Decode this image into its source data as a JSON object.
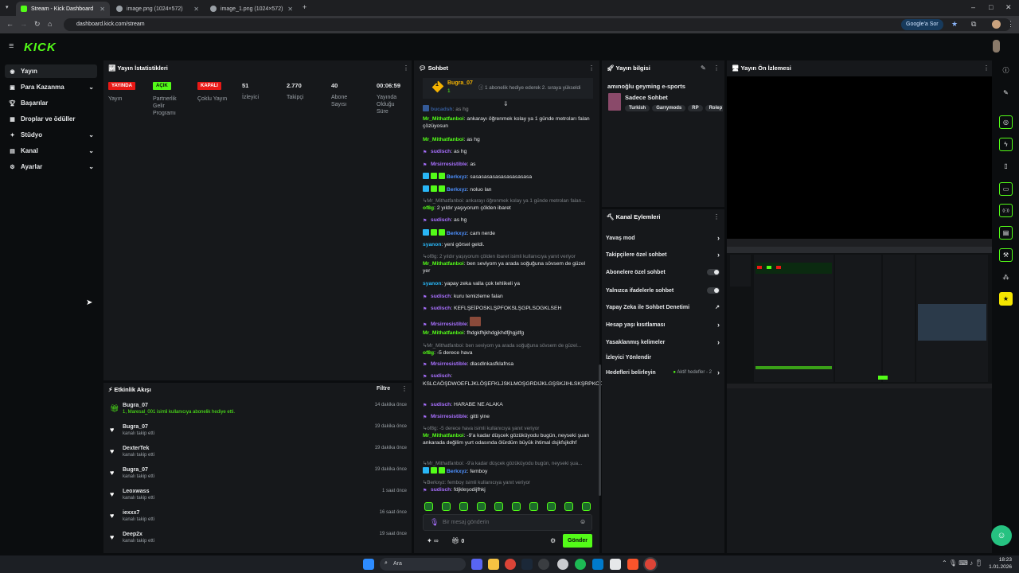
{
  "browser": {
    "tabs": [
      {
        "title": "Stream - Kick Dashboard",
        "active": true
      },
      {
        "title": "image.png (1024×572)",
        "active": false
      },
      {
        "title": "image_1.png (1024×572)",
        "active": false
      }
    ],
    "new_tab": "+",
    "url": "dashboard.kick.com/stream",
    "google_sor": "Google'a Sor"
  },
  "brand": {
    "logo": "KICK",
    "accent": "#53fc18"
  },
  "sidebar": {
    "items": [
      {
        "label": "Yayın",
        "icon": "broadcast-icon"
      },
      {
        "label": "Para Kazanma",
        "icon": "money-icon",
        "chevron": "⌄"
      },
      {
        "label": "Başarılar",
        "icon": "trophy-icon"
      },
      {
        "label": "Droplar ve ödüller",
        "icon": "gift-icon"
      },
      {
        "label": "Stüdyo",
        "icon": "studio-icon",
        "chevron": "⌄"
      },
      {
        "label": "Kanal",
        "icon": "channel-icon",
        "chevron": "⌄"
      },
      {
        "label": "Ayarlar",
        "icon": "gear-icon",
        "chevron": "⌄"
      }
    ]
  },
  "stats": {
    "title": "Yayın İstatistikleri",
    "items": [
      {
        "badge": "YAYINDA",
        "badge_color": "#e91916",
        "label": "Yayın"
      },
      {
        "badge": "AÇIK",
        "badge_color": "#53fc18",
        "label": "Partnerlik Gelir Programı"
      },
      {
        "badge": "KAPALI",
        "badge_color": "#e91916",
        "label": "Çoklu Yayın"
      },
      {
        "value": "51",
        "label": "İzleyici"
      },
      {
        "value": "2.770",
        "label": "Takipçi"
      },
      {
        "value": "40",
        "label": "Abone Sayısı"
      },
      {
        "value": "00:06:59",
        "label": "Yayında Olduğu Süre"
      }
    ]
  },
  "chat": {
    "title": "Sohbet",
    "pinned_user": "Bugra_07",
    "pinned_count": "1",
    "pinned_text": "1 abonelik hediye ederek 2. sıraya yükseldi",
    "partial_user": "bucadsh",
    "partial_msg": "as hg",
    "messages": [
      {
        "user": "Mr_Mithatfanboi",
        "color": "g",
        "text": "ankarayı öğrenmek kolay ya 1 günde metroları falan çözüyosun"
      },
      {
        "user": "Mr_Mithatfanboi",
        "color": "g",
        "text": "as hg"
      },
      {
        "user": "sudisch",
        "color": "p",
        "text": "as hg",
        "badges": 1
      },
      {
        "user": "Mrsirresistible",
        "color": "p",
        "text": "as",
        "badges": 1
      },
      {
        "user": "Berkxyz",
        "color": "b",
        "text": "sasasasasasasasasasasa",
        "badges": 3
      },
      {
        "user": "Berkxyz",
        "color": "b",
        "text": "noluo lan",
        "badges": 3
      },
      {
        "reply": "Mr_Mithatfanboi: ankarayı öğrenmek kolay ya 1 günde metroları falan...",
        "user": "of8g",
        "color": "g",
        "text": "2 yıldır yaşıyorum çölden ibaret"
      },
      {
        "user": "sudisch",
        "color": "p",
        "text": "as hg",
        "badges": 1
      },
      {
        "user": "Berkxyz",
        "color": "b",
        "text": "cam nerde",
        "badges": 3
      },
      {
        "user": "syanon",
        "color": "c",
        "text": "yeni görsel geldi."
      },
      {
        "reply": "of8g: 2 yıldır yaşıyorum çölden ibaret isimli kullanıcıya yanıt veriyor",
        "user": "Mr_Mithatfanboi",
        "color": "g",
        "text": "ben seviyom ya arada soğuğuna sövsem de güzel yer"
      },
      {
        "user": "syanon",
        "color": "c",
        "text": "yapay zeka valla çok tehlikeli ya"
      },
      {
        "user": "sudisch",
        "color": "p",
        "text": "kuru temizleme falan",
        "badges": 1
      },
      {
        "user": "sudisch",
        "color": "p",
        "text": "KEFLŞEİPOSKLŞPFOKSLŞGPLSOGKLSEH",
        "badges": 1
      },
      {
        "user": "Mrsirresistible",
        "color": "p",
        "text": "",
        "badges": 1,
        "image": true
      },
      {
        "user": "Mr_Mithatfanboi",
        "color": "g",
        "text": "fhdgkfhjkhdgjkhdfjhgjdfg"
      },
      {
        "reply": "Mr_Mithatfanboi: ben seviyom ya arada soğuğuna sövsem de güzel...",
        "user": "of8g",
        "color": "g",
        "text": "-5 derece hava"
      },
      {
        "user": "Mrsirresistible",
        "color": "p",
        "text": "dlasdlnkasfklafnsa",
        "badges": 1
      },
      {
        "user": "sudisch",
        "color": "p",
        "text": "KSLCAÖŞDWOEFLJKLÖŞEFKLJSKLMOŞGRDIJKLGŞSKJIHLSKŞRPKOGIJSLKEŞG",
        "badges": 1,
        "newline": true
      },
      {
        "user": "sudisch",
        "color": "p",
        "text": "HARABE NE ALAKA",
        "badges": 1
      },
      {
        "user": "Mrsirresistible",
        "color": "p",
        "text": "gitti yine",
        "badges": 1
      },
      {
        "reply": "of8g: -5 derece hava isimli kullanıcıya yanıt veriyor",
        "user": "Mr_Mithatfanboi",
        "color": "g",
        "text": "-9'a kadar düşcek gözüküyodu bugün, neyseki şuan ankarada değilim yurt odasında ölürdüm büyük ihtimal dsjkfsjkdhf"
      },
      {
        "reply": "Mr_Mithatfanboi: -9'a kadar düşcek gözüküyodu bugün, neyseki şua...",
        "user": "Berkxyz",
        "color": "b",
        "text": "femboy",
        "badges": 3
      },
      {
        "reply": "Berkxyz: femboy isimli kullanıcıya yanıt veriyor",
        "user": "sudisch",
        "color": "p",
        "text": "fdjkleşodijfhkj",
        "badges": 1
      }
    ],
    "input_placeholder": "Bir mesaj gönderin",
    "infinity": "∞",
    "gift_count": "0",
    "send_label": "Gönder"
  },
  "stream_info": {
    "title": "Yayın bilgisi",
    "stream_title": "amınoğlu geyming e-sports",
    "category": "Sadece Sohbet",
    "tags": [
      "Turkish",
      "Garrymods",
      "RP",
      "Rolep"
    ]
  },
  "channel_actions": {
    "title": "Kanal Eylemleri",
    "items": [
      {
        "label": "Yavaş mod",
        "control": "chevron"
      },
      {
        "label": "Takipçilere özel sohbet",
        "control": "chevron"
      },
      {
        "label": "Abonelere özel sohbet",
        "control": "toggle"
      },
      {
        "label": "Yalnızca ifadelerle sohbet",
        "control": "toggle"
      },
      {
        "label": "Yapay Zeka ile Sohbet Denetimi",
        "control": "external"
      },
      {
        "label": "Hesap yaşı kısıtlaması",
        "control": "chevron"
      },
      {
        "label": "Yasaklanmış kelimeler",
        "control": "chevron"
      },
      {
        "label": "İzleyici Yönlendir",
        "control": "none"
      },
      {
        "label": "Hedefleri belirleyin",
        "control": "chevron",
        "status": "Aktif hedefler - 2"
      }
    ]
  },
  "preview": {
    "title": "Yayın Ön İzlemesi"
  },
  "activity": {
    "title": "Etkinlik Akışı",
    "filter_label": "Filtre",
    "events": [
      {
        "user": "Bugra_07",
        "sub": "1, Maresal_001 isimli kullanıcıya abonelik hediye etti.",
        "time": "14 dakika önce",
        "icon": "gift-icon"
      },
      {
        "user": "Bugra_07",
        "sub": "kanalı takip etti",
        "time": "19 dakika önce",
        "icon": "heart-icon"
      },
      {
        "user": "DexterTek",
        "sub": "kanalı takip etti",
        "time": "19 dakika önce",
        "icon": "heart-icon"
      },
      {
        "user": "Bugra_07",
        "sub": "kanalı takip etti",
        "time": "19 dakika önce",
        "icon": "heart-icon"
      },
      {
        "user": "Leoxwass",
        "sub": "kanalı takip etti",
        "time": "1 saat önce",
        "icon": "heart-icon"
      },
      {
        "user": "iexxx7",
        "sub": "kanalı takip etti",
        "time": "16 saat önce",
        "icon": "heart-icon"
      },
      {
        "user": "Deep2x",
        "sub": "kanalı takip etti",
        "time": "19 saat önce",
        "icon": "heart-icon"
      }
    ]
  },
  "taskbar": {
    "search": "Ara",
    "time": "18:23",
    "date": "1.01.2026"
  }
}
